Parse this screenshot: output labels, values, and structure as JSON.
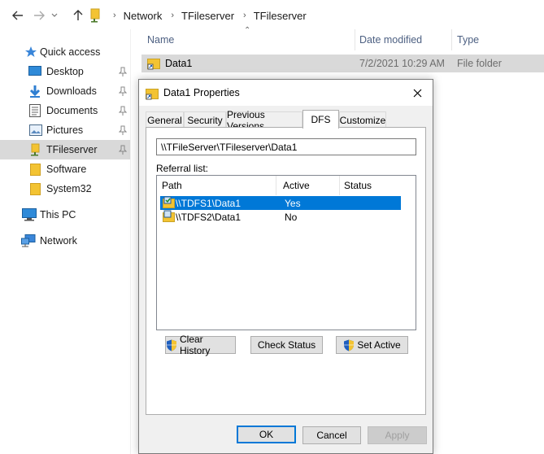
{
  "breadcrumb": [
    "Network",
    "TFileserver",
    "TFileserver"
  ],
  "sidebar": {
    "items": [
      {
        "label": "Quick access",
        "icon": "star-icon"
      },
      {
        "label": "Desktop",
        "icon": "desktop-icon",
        "pinned": true
      },
      {
        "label": "Downloads",
        "icon": "download-icon",
        "pinned": true
      },
      {
        "label": "Documents",
        "icon": "documents-icon",
        "pinned": true
      },
      {
        "label": "Pictures",
        "icon": "pictures-icon",
        "pinned": true
      },
      {
        "label": "TFileserver",
        "icon": "network-folder-icon",
        "pinned": true,
        "selected": true
      },
      {
        "label": "Software",
        "icon": "folder-icon"
      },
      {
        "label": "System32",
        "icon": "folder-icon"
      },
      {
        "label": "This PC",
        "icon": "computer-icon"
      },
      {
        "label": "Network",
        "icon": "network-icon"
      }
    ]
  },
  "file_list": {
    "columns": {
      "name": "Name",
      "date": "Date modified",
      "type": "Type"
    },
    "rows": [
      {
        "name": "Data1",
        "date": "7/2/2021 10:29 AM",
        "type": "File folder"
      }
    ]
  },
  "dialog": {
    "title": "Data1 Properties",
    "tabs": [
      "General",
      "Security",
      "Previous Versions",
      "DFS",
      "Customize"
    ],
    "active_tab": "DFS",
    "path": "\\\\TFileServer\\TFileserver\\Data1",
    "referral_label": "Referral list:",
    "list": {
      "columns": {
        "path": "Path",
        "active": "Active",
        "status": "Status"
      },
      "rows": [
        {
          "path": "\\\\TDFS1\\Data1",
          "active": "Yes",
          "status": "",
          "selected": true
        },
        {
          "path": "\\\\TDFS2\\Data1",
          "active": "No",
          "status": "",
          "selected": false
        }
      ]
    },
    "buttons": {
      "clear_history": "Clear History",
      "check_status": "Check Status",
      "set_active": "Set Active",
      "ok": "OK",
      "cancel": "Cancel",
      "apply": "Apply"
    }
  },
  "colors": {
    "accent": "#0078d7",
    "selection": "#d9d9d9",
    "folder": "#f3c332"
  }
}
